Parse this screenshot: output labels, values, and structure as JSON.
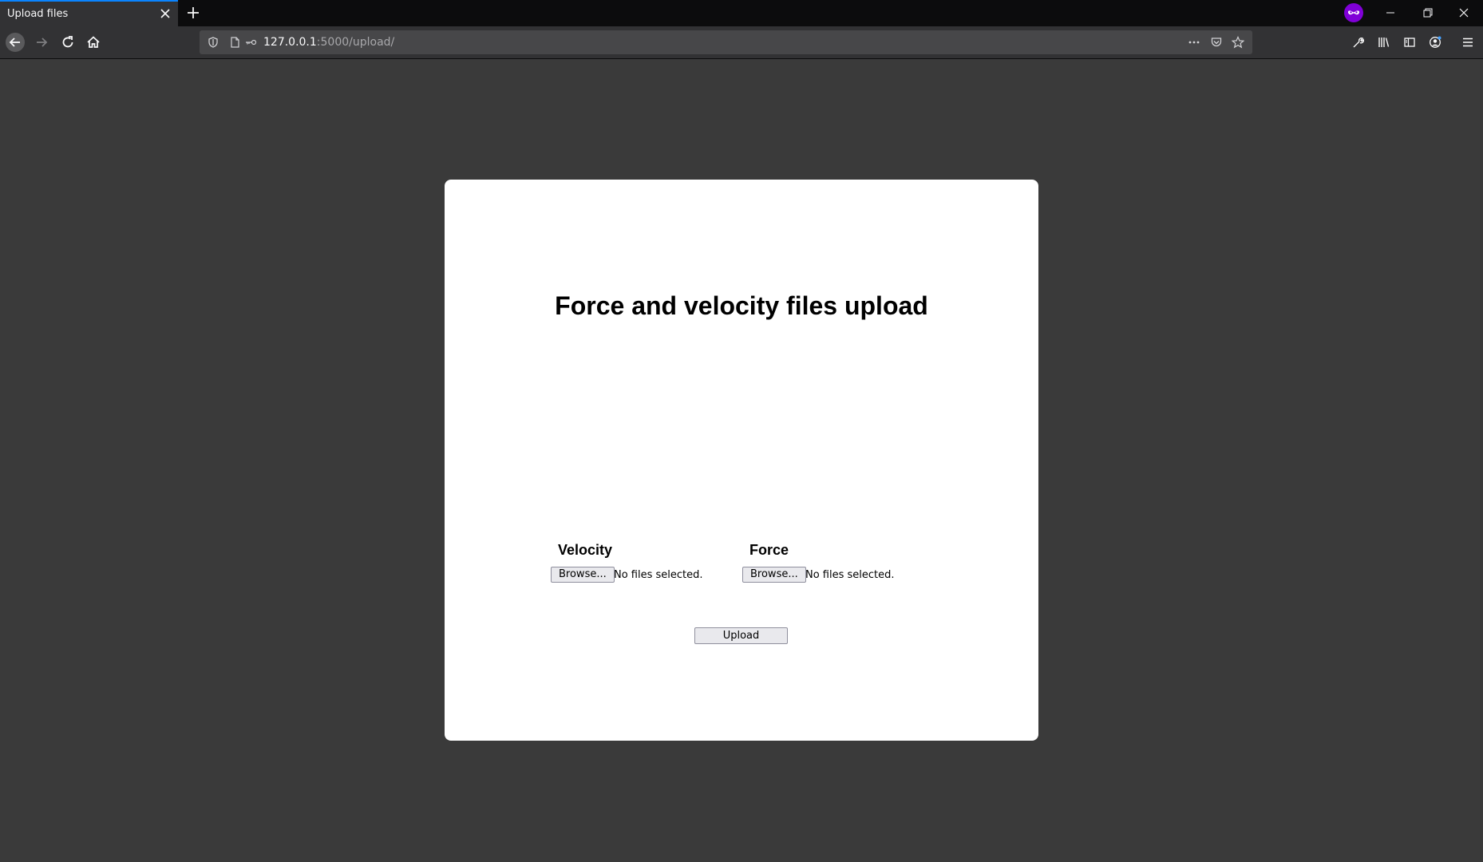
{
  "browser": {
    "tab_title": "Upload files",
    "url_host": "127.0.0.1",
    "url_path": ":5000/upload/"
  },
  "page": {
    "title": "Force and velocity files upload",
    "velocity": {
      "label": "Velocity",
      "browse_label": "Browse...",
      "status": "No files selected."
    },
    "force": {
      "label": "Force",
      "browse_label": "Browse...",
      "status": "No files selected."
    },
    "upload_label": "Upload"
  }
}
